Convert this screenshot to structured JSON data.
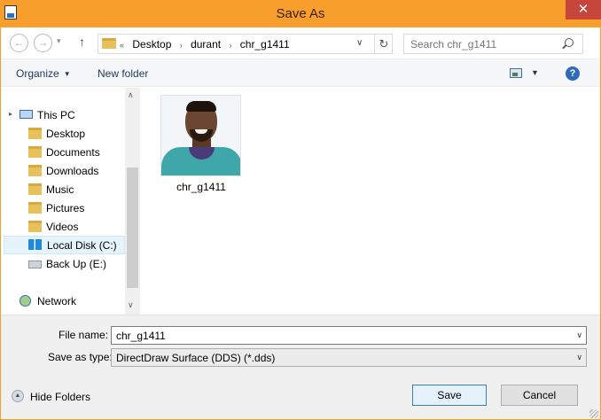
{
  "window": {
    "title": "Save As",
    "close_glyph": "✕",
    "accent_color": "#f89e2d"
  },
  "navigation": {
    "back_glyph": "←",
    "forward_glyph": "→",
    "dropdown_glyph": "▾",
    "up_glyph": "↑",
    "breadcrumb_prefix": "«",
    "breadcrumbs": [
      "Desktop",
      "durant",
      "chr_g1411"
    ],
    "separator": "›",
    "address_dropdown_glyph": "∨",
    "refresh_glyph": "↻",
    "search_placeholder": "Search chr_g1411"
  },
  "toolbar": {
    "organize_label": "Organize",
    "organize_dropdown_glyph": "▼",
    "new_folder_label": "New folder",
    "view_dropdown_glyph": "▼",
    "help_glyph": "?"
  },
  "sidebar": {
    "this_pc": "This PC",
    "items": [
      {
        "label": "Desktop",
        "icon": "desktop-folder-icon"
      },
      {
        "label": "Documents",
        "icon": "documents-folder-icon"
      },
      {
        "label": "Downloads",
        "icon": "downloads-folder-icon"
      },
      {
        "label": "Music",
        "icon": "music-folder-icon"
      },
      {
        "label": "Pictures",
        "icon": "pictures-folder-icon"
      },
      {
        "label": "Videos",
        "icon": "videos-folder-icon"
      },
      {
        "label": "Local Disk (C:)",
        "icon": "local-disk-icon",
        "selected": true
      },
      {
        "label": "Back Up (E:)",
        "icon": "drive-icon"
      }
    ],
    "network": "Network",
    "expander_glyph": "▸",
    "scroll_up_glyph": "∧",
    "scroll_down_glyph": "∨"
  },
  "content": {
    "files": [
      {
        "name": "chr_g1411",
        "icon": "image-thumbnail"
      }
    ]
  },
  "save_panel": {
    "file_name_label": "File name:",
    "file_name_value": "chr_g1411",
    "save_as_type_label": "Save as type:",
    "save_as_type_value": "DirectDraw Surface (DDS) (*.dds)",
    "dropdown_glyph": "∨",
    "hide_folders_label": "Hide Folders",
    "hide_folders_glyph": "▲",
    "save_button": "Save",
    "cancel_button": "Cancel"
  }
}
